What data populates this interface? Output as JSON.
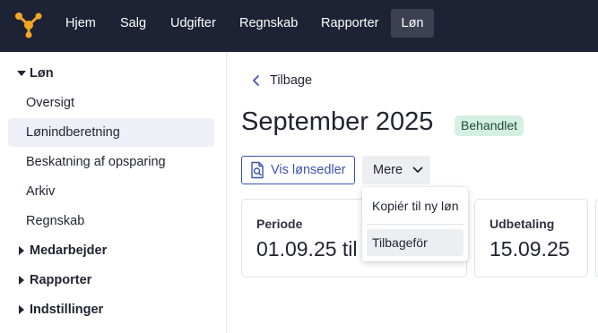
{
  "topnav": {
    "logo": "brand-logo",
    "items": [
      {
        "label": "Hjem",
        "active": false
      },
      {
        "label": "Salg",
        "active": false
      },
      {
        "label": "Udgifter",
        "active": false
      },
      {
        "label": "Regnskab",
        "active": false
      },
      {
        "label": "Rapporter",
        "active": false
      },
      {
        "label": "Løn",
        "active": true
      }
    ]
  },
  "sidebar": {
    "sections": [
      {
        "label": "Løn",
        "expanded": true
      },
      {
        "label": "Medarbejder",
        "expanded": false
      },
      {
        "label": "Rapporter",
        "expanded": false
      },
      {
        "label": "Indstillinger",
        "expanded": false
      }
    ],
    "items": [
      {
        "label": "Oversigt",
        "active": false
      },
      {
        "label": "Lønindberetning",
        "active": true
      },
      {
        "label": "Beskatning af opsparing",
        "active": false
      },
      {
        "label": "Arkiv",
        "active": false
      },
      {
        "label": "Regnskab",
        "active": false
      }
    ]
  },
  "main": {
    "back_label": "Tilbage",
    "title": "September 2025",
    "status_badge": "Behandlet",
    "view_payslips_label": "Vis lønsedler",
    "more_label": "Mere",
    "cards": [
      {
        "label": "Periode",
        "value": "01.09.25 til"
      },
      {
        "label": "Udbetaling",
        "value": "15.09.25"
      }
    ],
    "menu": {
      "items": [
        {
          "label": "Kopiér til ny løn"
        },
        {
          "label": "Tilbageför",
          "hovered": true
        }
      ]
    }
  },
  "colors": {
    "topbar_bg": "#1e2235",
    "accent_blue": "#3b55b0",
    "badge_bg": "#d5f0e3",
    "logo_orange": "#f5a623"
  }
}
